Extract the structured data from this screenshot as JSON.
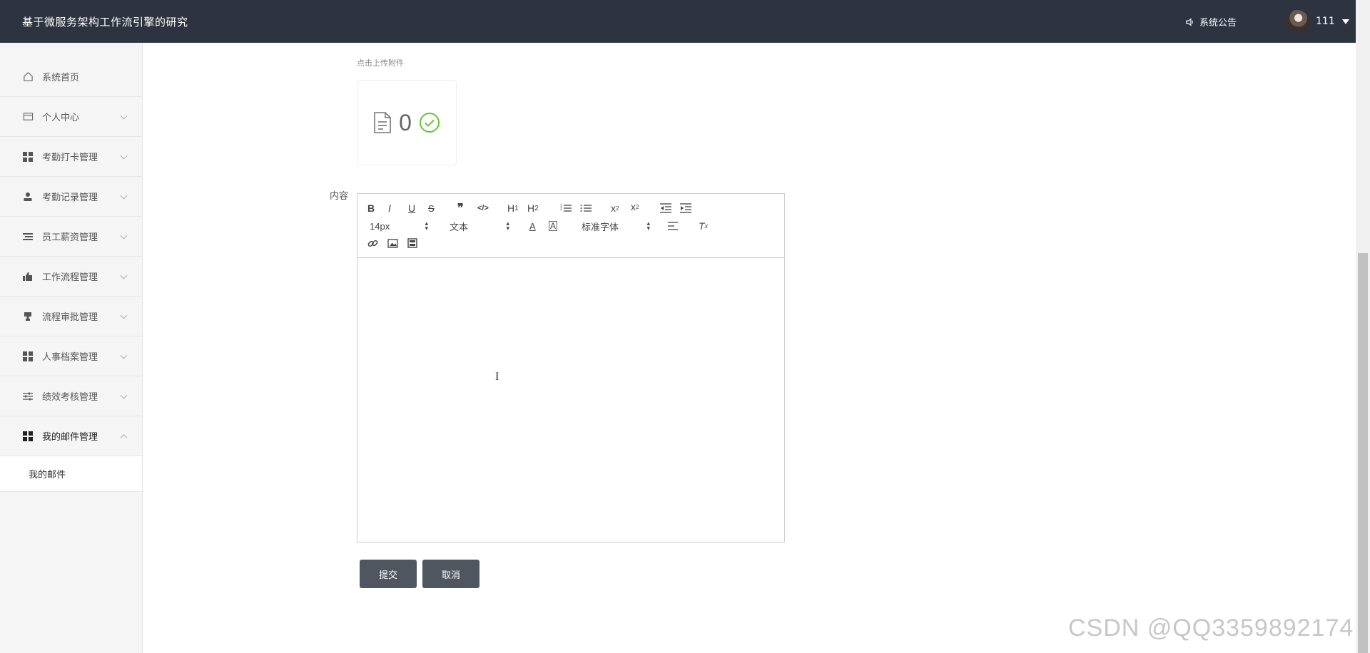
{
  "header": {
    "title": "基于微服务架构工作流引擎的研究",
    "notice_label": "系统公告",
    "username": "111"
  },
  "sidebar": {
    "items": [
      {
        "label": "系统首页",
        "icon": "home-icon"
      },
      {
        "label": "个人中心",
        "icon": "card-icon"
      },
      {
        "label": "考勤打卡管理",
        "icon": "grid-icon"
      },
      {
        "label": "考勤记录管理",
        "icon": "person-icon"
      },
      {
        "label": "员工薪资管理",
        "icon": "list-icon"
      },
      {
        "label": "工作流程管理",
        "icon": "thumb-icon"
      },
      {
        "label": "流程审批管理",
        "icon": "stamp-icon"
      },
      {
        "label": "人事档案管理",
        "icon": "grid-icon"
      },
      {
        "label": "绩效考核管理",
        "icon": "sliders-icon"
      },
      {
        "label": "我的邮件管理",
        "icon": "grid-icon"
      }
    ],
    "sub_item": "我的邮件"
  },
  "form": {
    "upload_tip": "点击上传附件",
    "upload_count": "0",
    "content_label": "内容",
    "font_size": "14px",
    "text_type": "文本",
    "font_family": "标准字体",
    "submit_label": "提交",
    "cancel_label": "取消"
  },
  "watermark": "CSDN @QQ3359892174",
  "colors": {
    "header_bg": "#2d3440",
    "button_bg": "#4f565f",
    "success": "#67c23a"
  }
}
